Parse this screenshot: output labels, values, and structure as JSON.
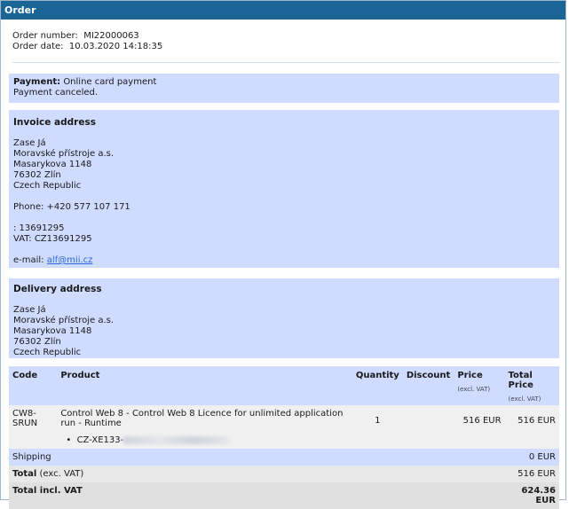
{
  "header": {
    "title": "Order"
  },
  "order": {
    "number_label": "Order number:",
    "number": "MI22000063",
    "date_label": "Order date:",
    "date": "10.03.2020 14:18:35"
  },
  "payment": {
    "label": "Payment:",
    "method": "Online card payment",
    "status": "Payment canceled."
  },
  "invoice": {
    "title": "Invoice address",
    "name": "Zase Já",
    "company": "Moravské přístroje a.s.",
    "street": "Masarykova 1148",
    "city": "76302 Zlín",
    "country": "Czech Republic",
    "phone": "Phone: +420 577 107 171",
    "id_line": ": 13691295",
    "vat_line": "VAT: CZ13691295",
    "email_label": "e-mail:",
    "email": "alf@mii.cz"
  },
  "delivery": {
    "title": "Delivery address",
    "name": "Zase Já",
    "company": "Moravské přístroje a.s.",
    "street": "Masarykova 1148",
    "city": "76302 Zlín",
    "country": "Czech Republic"
  },
  "table": {
    "headers": {
      "code": "Code",
      "product": "Product",
      "quantity": "Quantity",
      "discount": "Discount",
      "price": "Price",
      "price_sub": "(excl. VAT)",
      "total": "Total Price",
      "total_sub": "(excl. VAT)"
    },
    "item": {
      "code": "CW8-SRUN",
      "product": "Control Web 8 - Control Web 8 Licence for unlimited application run - Runtime",
      "license_prefix": "CZ-XE133-",
      "quantity": "1",
      "discount": "",
      "price": "516 EUR",
      "total": "516 EUR"
    },
    "shipping": {
      "label": "Shipping",
      "value": "0 EUR"
    },
    "total_exc": {
      "label": "Total",
      "suffix": "(exc. VAT)",
      "value": "516 EUR"
    },
    "total_inc": {
      "label": "Total incl. VAT",
      "value": "624.36 EUR"
    }
  }
}
